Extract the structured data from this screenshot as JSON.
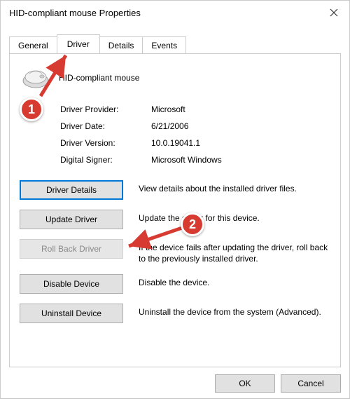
{
  "window": {
    "title": "HID-compliant mouse Properties"
  },
  "tabs": {
    "general": "General",
    "driver": "Driver",
    "details": "Details",
    "events": "Events"
  },
  "device": {
    "name": "HID-compliant mouse"
  },
  "info": {
    "provider_label": "Driver Provider:",
    "provider_value": "Microsoft",
    "date_label": "Driver Date:",
    "date_value": "6/21/2006",
    "version_label": "Driver Version:",
    "version_value": "10.0.19041.1",
    "signer_label": "Digital Signer:",
    "signer_value": "Microsoft Windows"
  },
  "actions": {
    "details_btn": "Driver Details",
    "details_desc": "View details about the installed driver files.",
    "update_btn": "Update Driver",
    "update_desc": "Update the driver for this device.",
    "rollback_btn": "Roll Back Driver",
    "rollback_desc": "If the device fails after updating the driver, roll back to the previously installed driver.",
    "disable_btn": "Disable Device",
    "disable_desc": "Disable the device.",
    "uninstall_btn": "Uninstall Device",
    "uninstall_desc": "Uninstall the device from the system (Advanced)."
  },
  "dialog": {
    "ok": "OK",
    "cancel": "Cancel"
  },
  "annotations": {
    "badge1": "1",
    "badge2": "2"
  }
}
